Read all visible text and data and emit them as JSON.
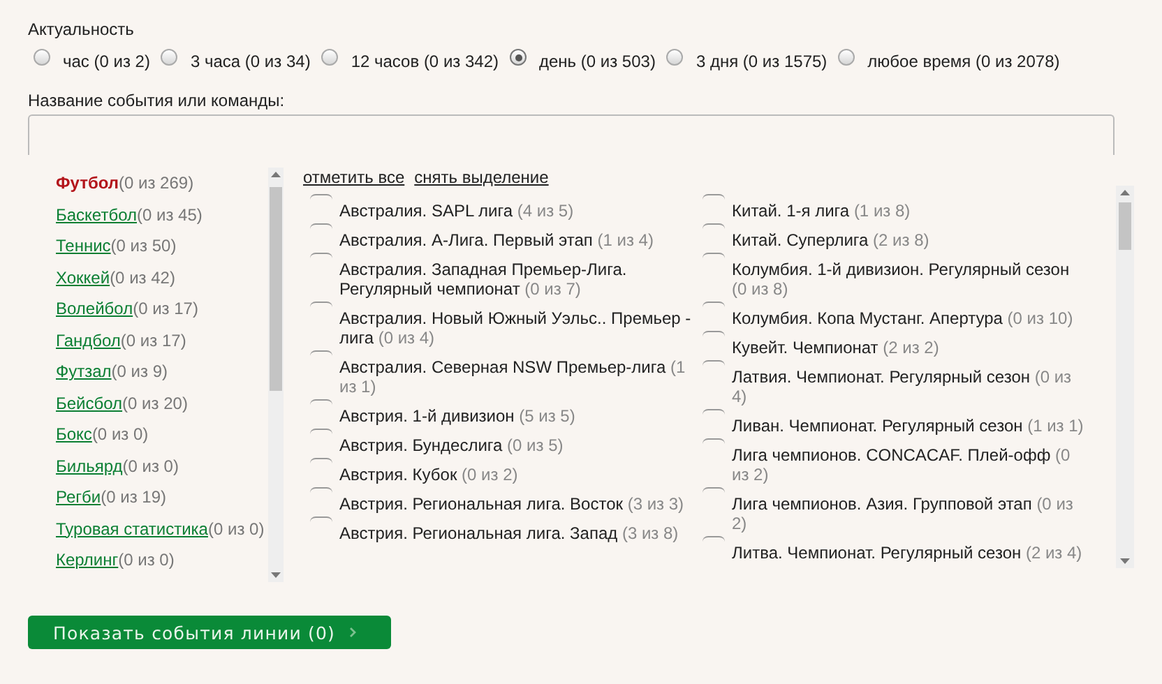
{
  "relevance": {
    "title": "Актуальность",
    "options": [
      {
        "label": "час (0 из 2)",
        "selected": false
      },
      {
        "label": "3 часа (0 из 34)",
        "selected": false
      },
      {
        "label": "12 часов (0 из 342)",
        "selected": false
      },
      {
        "label": "день (0 из 503)",
        "selected": true
      },
      {
        "label": "3 дня (0 из 1575)",
        "selected": false
      },
      {
        "label": "любое время (0 из 2078)",
        "selected": false
      }
    ]
  },
  "search": {
    "label": "Название события или команды:"
  },
  "sports": [
    {
      "name": "Футбол",
      "count": "(0 из 269)",
      "selected": true
    },
    {
      "name": "Баскетбол",
      "count": "(0 из 45)",
      "selected": false
    },
    {
      "name": "Теннис",
      "count": "(0 из 50)",
      "selected": false
    },
    {
      "name": "Хоккей",
      "count": "(0 из 42)",
      "selected": false
    },
    {
      "name": "Волейбол",
      "count": "(0 из 17)",
      "selected": false
    },
    {
      "name": "Гандбол",
      "count": "(0 из 17)",
      "selected": false
    },
    {
      "name": "Футзал",
      "count": "(0 из 9)",
      "selected": false
    },
    {
      "name": "Бейсбол",
      "count": "(0 из 20)",
      "selected": false
    },
    {
      "name": "Бокс",
      "count": "(0 из 0)",
      "selected": false
    },
    {
      "name": "Бильярд",
      "count": "(0 из 0)",
      "selected": false
    },
    {
      "name": "Регби",
      "count": "(0 из 19)",
      "selected": false
    },
    {
      "name": "Туровая статистика",
      "count": "(0 из 0)",
      "selected": false
    },
    {
      "name": "Керлинг",
      "count": "(0 из 0)",
      "selected": false
    }
  ],
  "league_actions": [
    "отметить все",
    "снять выделение"
  ],
  "leagues": [
    [
      {
        "name": "Австралия. SAPL лига",
        "count": "(4 из 5)",
        "checked": false
      },
      {
        "name": "Австралия. А-Лига. Первый этап",
        "count": "(1 из 4)",
        "checked": false
      },
      {
        "name": "Австралия. Западная Премьер-Лига. Регулярный чемпионат",
        "count": "(0 из 7)",
        "checked": false
      },
      {
        "name": "Австралия. Новый Южный Уэльс.. Премьер - лига",
        "count": "(0 из 4)",
        "checked": false
      },
      {
        "name": "Австралия. Северная NSW Премьер-лига",
        "count": "(1 из 1)",
        "checked": false
      },
      {
        "name": "Австрия. 1-й дивизион",
        "count": "(5 из 5)",
        "checked": false
      },
      {
        "name": "Австрия. Бундеслига",
        "count": "(0 из 5)",
        "checked": false
      },
      {
        "name": "Австрия. Кубок",
        "count": "(0 из 2)",
        "checked": false
      },
      {
        "name": "Австрия. Региональная лига. Восток",
        "count": "(3 из 3)",
        "checked": false
      },
      {
        "name": "Австрия. Региональная лига. Запад",
        "count": "(3 из 8)",
        "checked": false
      }
    ],
    [
      {
        "name": "Китай. 1-я лига",
        "count": "(1 из 8)",
        "checked": false
      },
      {
        "name": "Китай. Суперлига",
        "count": "(2 из 8)",
        "checked": false
      },
      {
        "name": "Колумбия. 1-й дивизион. Регулярный сезон",
        "count": "(0 из 8)",
        "checked": false
      },
      {
        "name": "Колумбия. Копа Мустанг. Апертура",
        "count": "(0 из 10)",
        "checked": false
      },
      {
        "name": "Кувейт. Чемпионат",
        "count": "(2 из 2)",
        "checked": false
      },
      {
        "name": "Латвия. Чемпионат. Регулярный сезон",
        "count": "(0 из 4)",
        "checked": false
      },
      {
        "name": "Ливан. Чемпионат. Регулярный сезон",
        "count": "(1 из 1)",
        "checked": false
      },
      {
        "name": "Лига чемпионов. CONCACAF. Плей-офф",
        "count": "(0 из 2)",
        "checked": false
      },
      {
        "name": "Лига чемпионов. Азия. Групповой этап",
        "count": "(0 из 2)",
        "checked": false
      },
      {
        "name": "Литва. Чемпионат. Регулярный сезон",
        "count": "(2 из 4)",
        "checked": false
      }
    ]
  ],
  "submit": {
    "label": "Показать события линии (0)"
  }
}
